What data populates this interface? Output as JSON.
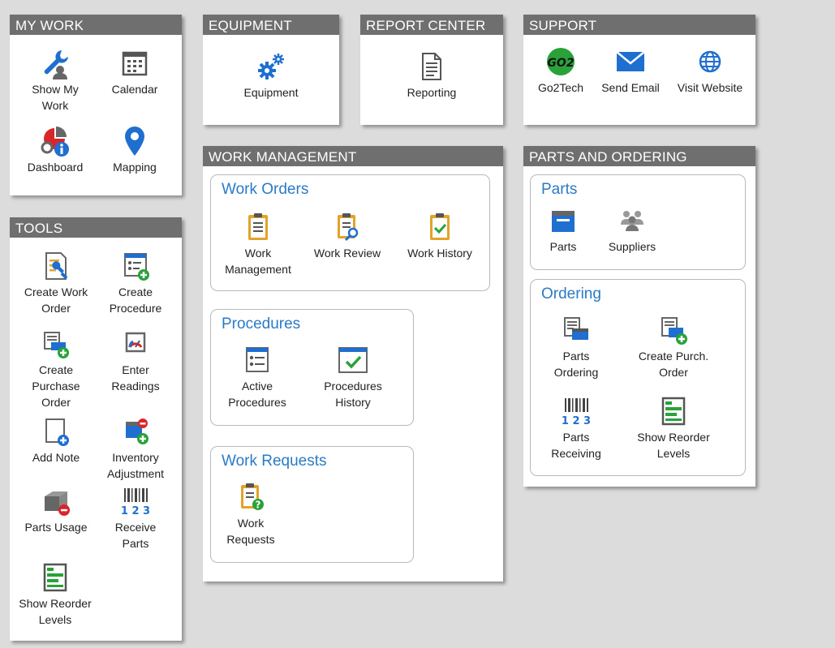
{
  "colors": {
    "header_bg": "#6f6f6f",
    "accent": "#2a7bc7",
    "green": "#2aa23a",
    "red": "#d9262b",
    "orange": "#e3a32a"
  },
  "my_work": {
    "title": "MY WORK",
    "items": [
      {
        "label": "Show My\nWork",
        "icon": "wrench-user-icon"
      },
      {
        "label": "Calendar",
        "icon": "calendar-icon"
      },
      {
        "label": "Dashboard",
        "icon": "dashboard-icon"
      },
      {
        "label": "Mapping",
        "icon": "map-pin-icon"
      }
    ]
  },
  "tools": {
    "title": "TOOLS",
    "items": [
      {
        "label": "Create Work\nOrder",
        "icon": "create-work-order-icon"
      },
      {
        "label": "Create\nProcedure",
        "icon": "create-procedure-icon"
      },
      {
        "label": "Create\nPurchase\nOrder",
        "icon": "create-purchase-order-icon"
      },
      {
        "label": "Enter\nReadings",
        "icon": "gauge-icon"
      },
      {
        "label": "Add Note",
        "icon": "add-note-icon"
      },
      {
        "label": "Inventory\nAdjustment",
        "icon": "inventory-adjustment-icon"
      },
      {
        "label": "Parts Usage",
        "icon": "parts-usage-icon"
      },
      {
        "label": "Receive\nParts",
        "icon": "barcode-icon"
      },
      {
        "label": "Show Reorder\nLevels",
        "icon": "reorder-levels-icon"
      }
    ]
  },
  "equipment": {
    "title": "EQUIPMENT",
    "items": [
      {
        "label": "Equipment",
        "icon": "gears-icon"
      }
    ]
  },
  "report_center": {
    "title": "REPORT CENTER",
    "items": [
      {
        "label": "Reporting",
        "icon": "document-icon"
      }
    ]
  },
  "support": {
    "title": "SUPPORT",
    "items": [
      {
        "label": "Go2Tech",
        "icon": "go2tech-icon",
        "logo_text": "GO2"
      },
      {
        "label": "Send Email",
        "icon": "envelope-icon"
      },
      {
        "label": "Visit Website",
        "icon": "globe-icon"
      }
    ]
  },
  "work_management": {
    "title": "WORK MANAGEMENT",
    "groups": [
      {
        "title": "Work Orders",
        "items": [
          {
            "label": "Work\nManagement",
            "icon": "clipboard-icon"
          },
          {
            "label": "Work Review",
            "icon": "clipboard-search-icon"
          },
          {
            "label": "Work History",
            "icon": "clipboard-check-icon"
          }
        ]
      },
      {
        "title": "Procedures",
        "items": [
          {
            "label": "Active\nProcedures",
            "icon": "procedure-list-icon"
          },
          {
            "label": "Procedures\nHistory",
            "icon": "procedure-check-icon"
          }
        ]
      },
      {
        "title": "Work Requests",
        "items": [
          {
            "label": "Work\nRequests",
            "icon": "clipboard-question-icon"
          }
        ]
      }
    ]
  },
  "parts_ordering": {
    "title": "PARTS AND ORDERING",
    "groups": [
      {
        "title": "Parts",
        "items": [
          {
            "label": "Parts",
            "icon": "parts-box-icon"
          },
          {
            "label": "Suppliers",
            "icon": "suppliers-icon"
          }
        ]
      },
      {
        "title": "Ordering",
        "items": [
          {
            "label": "Parts\nOrdering",
            "icon": "parts-ordering-icon"
          },
          {
            "label": "Create Purch.\nOrder",
            "icon": "create-purch-order-icon"
          },
          {
            "label": "Parts\nReceiving",
            "icon": "barcode-icon"
          },
          {
            "label": "Show Reorder\nLevels",
            "icon": "reorder-levels-icon"
          }
        ]
      }
    ]
  }
}
